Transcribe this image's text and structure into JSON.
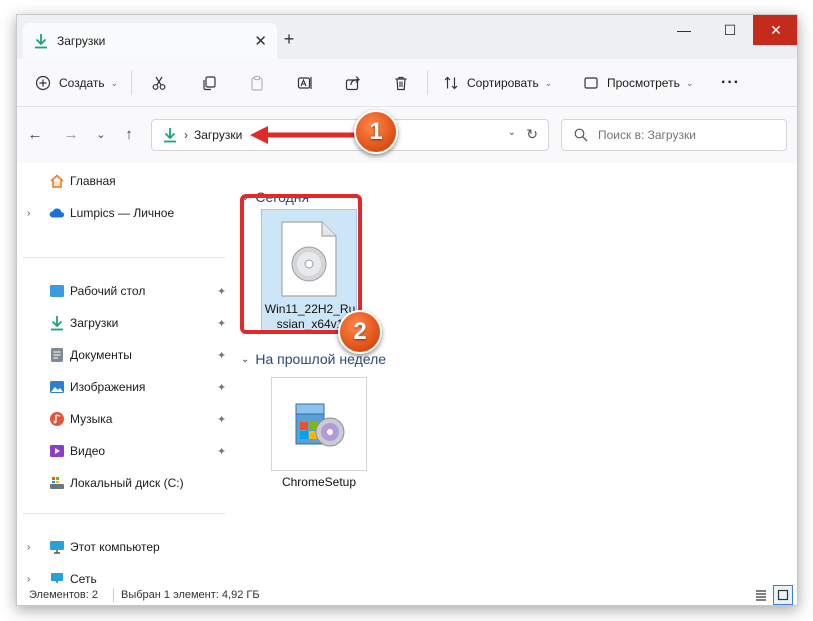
{
  "window": {
    "tab_title": "Загрузки",
    "tab_close": "✕",
    "new_tab": "+",
    "min": "—",
    "max": "☐",
    "close": "✕"
  },
  "toolbar": {
    "create_label": "Создать",
    "sort_label": "Сортировать",
    "view_label": "Просмотреть",
    "more": "···"
  },
  "address": {
    "separator": "›",
    "path": "Загрузки",
    "search_placeholder": "Поиск в: Загрузки"
  },
  "sidebar": {
    "items": [
      {
        "label": "Главная",
        "icon": "home-icon"
      },
      {
        "label": "Lumpics — Личное",
        "icon": "cloud-icon"
      },
      {
        "label": "Рабочий стол",
        "icon": "desktop-icon"
      },
      {
        "label": "Загрузки",
        "icon": "download-icon"
      },
      {
        "label": "Документы",
        "icon": "document-icon"
      },
      {
        "label": "Изображения",
        "icon": "picture-icon"
      },
      {
        "label": "Музыка",
        "icon": "music-icon"
      },
      {
        "label": "Видео",
        "icon": "video-icon"
      },
      {
        "label": "Локальный диск (C:)",
        "icon": "disk-icon"
      },
      {
        "label": "Этот компьютер",
        "icon": "computer-icon"
      },
      {
        "label": "Сеть",
        "icon": "network-icon"
      }
    ]
  },
  "content": {
    "groups": [
      {
        "title": "Сегодня"
      },
      {
        "title": "На прошлой неделе"
      }
    ],
    "files": [
      {
        "name": "Win11_22H2_Russian_x64v1",
        "icon": "disc-image-icon",
        "selected": true
      },
      {
        "name": "ChromeSetup",
        "icon": "installer-icon",
        "selected": false
      }
    ]
  },
  "annotations": {
    "badge1": "1",
    "badge2": "2",
    "colors": {
      "highlight": "#e02a2a",
      "badge": "#e2541a"
    }
  },
  "status": {
    "items_count": "Элементов: 2",
    "selection": "Выбран 1 элемент: 4,92 ГБ"
  }
}
